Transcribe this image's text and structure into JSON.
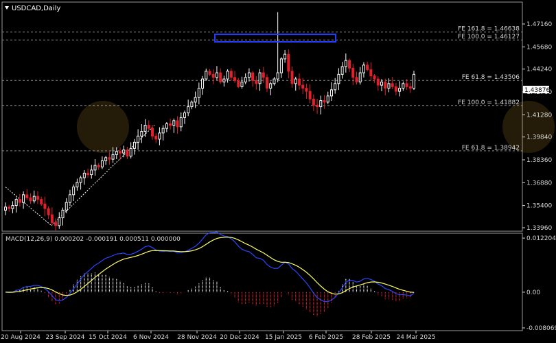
{
  "window": {
    "title": "USDCAD,Daily"
  },
  "colors": {
    "up": "#ffffff",
    "down": "#e0202a",
    "grid": "#8a8a8a",
    "macd_line": "#2a46ff",
    "signal_line": "#ffff66",
    "hist_pos": "#ffffff",
    "hist_neg": "#e0202a",
    "box": "#1f3cff",
    "axis": "#d8d8d8"
  },
  "chart_data": [
    {
      "type": "candlestick",
      "title": "USDCAD,Daily",
      "ylim": [
        1.3396,
        1.4716
      ],
      "yticks": [
        "1.47160",
        "1.45680",
        "1.44240",
        "1.42760",
        "1.41280",
        "1.39840",
        "1.38360",
        "1.36880",
        "1.35400",
        "1.33960"
      ],
      "current_price": "1.43876",
      "xticks": [
        "20 Aug 2024",
        "23 Sep 2024",
        "15 Oct 2024",
        "6 Nov 2024",
        "28 Nov 2024",
        "20 Dec 2024",
        "15 Jan 2025",
        "6 Feb 2025",
        "28 Feb 2025",
        "24 Mar 2025"
      ],
      "levels": [
        {
          "label": "FE 161.8 = 1.46638",
          "value": 1.46638
        },
        {
          "label": "FE 100.0 = 1.46127",
          "value": 1.46127
        },
        {
          "label": "FE 61.8 = 1.43506",
          "value": 1.43506
        },
        {
          "label": "FE 100.0 = 1.41882",
          "value": 1.41882
        },
        {
          "label": "FE 61.8 = 1.38942",
          "value": 1.38942
        }
      ],
      "close_path": [
        1.353,
        1.352,
        1.354,
        1.358,
        1.356,
        1.361,
        1.359,
        1.357,
        1.36,
        1.358,
        1.355,
        1.352,
        1.348,
        1.343,
        1.341,
        1.346,
        1.351,
        1.356,
        1.361,
        1.366,
        1.369,
        1.372,
        1.375,
        1.374,
        1.377,
        1.38,
        1.379,
        1.383,
        1.385,
        1.384,
        1.387,
        1.389,
        1.388,
        1.39,
        1.386,
        1.391,
        1.395,
        1.399,
        1.402,
        1.406,
        1.404,
        1.399,
        1.397,
        1.401,
        1.404,
        1.407,
        1.406,
        1.409,
        1.405,
        1.411,
        1.414,
        1.418,
        1.421,
        1.424,
        1.43,
        1.436,
        1.441,
        1.439,
        1.437,
        1.44,
        1.434,
        1.436,
        1.441,
        1.437,
        1.435,
        1.431,
        1.434,
        1.437,
        1.44,
        1.435,
        1.433,
        1.44,
        1.437,
        1.43,
        1.433,
        1.436,
        1.44,
        1.449,
        1.452,
        1.441,
        1.433,
        1.436,
        1.432,
        1.43,
        1.428,
        1.423,
        1.419,
        1.418,
        1.422,
        1.421,
        1.425,
        1.429,
        1.433,
        1.439,
        1.444,
        1.448,
        1.443,
        1.437,
        1.434,
        1.44,
        1.445,
        1.442,
        1.438,
        1.436,
        1.432,
        1.434,
        1.43,
        1.433,
        1.431,
        1.428,
        1.43,
        1.433,
        1.431,
        1.43,
        1.439
      ],
      "anchors": [
        {
          "x": "2024-08-20",
          "y": 1.353
        },
        {
          "x": "2024-09-25",
          "y": 1.341
        },
        {
          "x": "2024-11-05",
          "y": 1.4
        },
        {
          "x": "2024-12-19",
          "y": 1.44
        },
        {
          "x": "2025-02-03",
          "y": 1.4793
        },
        {
          "x": "2025-02-11",
          "y": 1.418
        },
        {
          "x": "2025-03-04",
          "y": 1.449
        },
        {
          "x": "2025-03-26",
          "y": 1.439
        }
      ]
    },
    {
      "type": "macd",
      "title": "MACD(12,26,9) 0.000202 -0.000191 0.000511 0.000000",
      "params": [
        12,
        26,
        9
      ],
      "values": {
        "histogram": 0.000202,
        "signal": -0.000191,
        "main": 0.000511,
        "level": 0.0
      },
      "ylim": [
        -0.008069,
        0.01222
      ],
      "yticks": [
        "0.012204",
        "0.00",
        "-0.008069"
      ]
    }
  ]
}
